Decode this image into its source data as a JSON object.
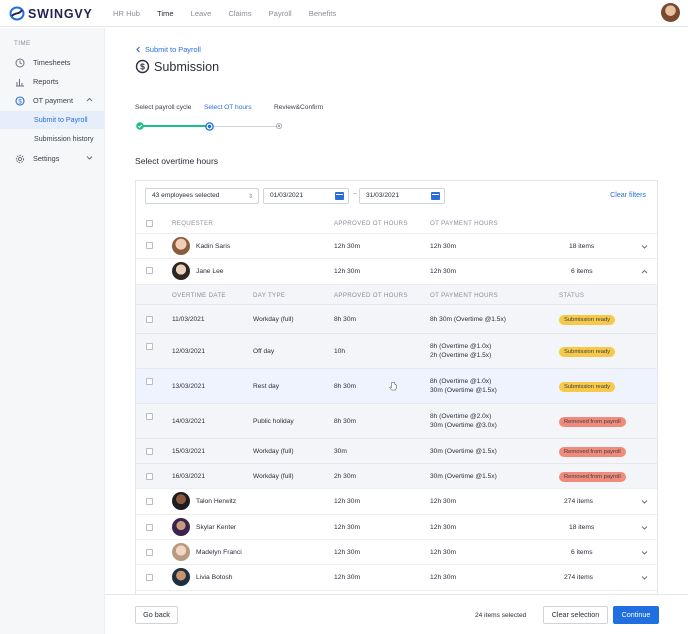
{
  "brand": {
    "name": "SWINGVY"
  },
  "nav": {
    "items": [
      "HR Hub",
      "Time",
      "Leave",
      "Claims",
      "Payroll",
      "Benefits"
    ],
    "active": "Time"
  },
  "sidebar": {
    "section": "TIME",
    "items": [
      {
        "label": "Timesheets",
        "icon": "clock-icon"
      },
      {
        "label": "Reports",
        "icon": "bar-chart-icon"
      },
      {
        "label": "OT payment",
        "icon": "dollar-circle-icon"
      },
      {
        "label": "Settings",
        "icon": "gear-icon"
      }
    ],
    "sub_items": [
      {
        "label": "Submit to Payroll",
        "active": true
      },
      {
        "label": "Submission history",
        "active": false
      }
    ]
  },
  "header": {
    "back_label": "Submit to Payroll",
    "title": "Submission"
  },
  "steps": [
    {
      "label": "Select payroll cycle",
      "state": "done"
    },
    {
      "label": "Select OT hours",
      "state": "active"
    },
    {
      "label": "Review&Confirm",
      "state": "pending"
    }
  ],
  "section_title": "Select overtime hours",
  "filters": {
    "employees": "43 employees selected",
    "date_from": "01/03/2021",
    "date_sep": "–",
    "date_to": "31/03/2021",
    "clear": "Clear filters"
  },
  "columns": {
    "requester": "REQUESTER",
    "approved": "APPROVED OT HOURS",
    "payment": "OT PAYMENT HOURS"
  },
  "sub_columns": {
    "date": "OVERTIME DATE",
    "day_type": "DAY TYPE",
    "approved": "APPROVED OT HOURS",
    "payment": "OT PAYMENT HOURS",
    "status": "STATUS"
  },
  "rows_before": [
    {
      "name": "Kadin Saris",
      "approved": "12h 30m",
      "payment": "12h 30m",
      "count": "18 items",
      "expanded": false
    },
    {
      "name": "Jane Lee",
      "approved": "12h 30m",
      "payment": "12h 30m",
      "count": "6 items",
      "expanded": true
    }
  ],
  "sub_rows": [
    {
      "date": "11/03/2021",
      "day_type": "Workday (full)",
      "approved": "8h 30m",
      "payment": [
        "8h 30m (Overtime @1.5x)"
      ],
      "status": "Submission ready",
      "status_kind": "ready"
    },
    {
      "date": "12/03/2021",
      "day_type": "Off day",
      "approved": "10h",
      "payment": [
        "8h (Overtime @1.0x)",
        "2h (Overtime @1.5x)"
      ],
      "status": "Submission ready",
      "status_kind": "ready"
    },
    {
      "date": "13/03/2021",
      "day_type": "Rest day",
      "approved": "8h 30m",
      "payment": [
        "8h (Overtime @1.0x)",
        "30m (Overtime @1.5x)"
      ],
      "status": "Submission ready",
      "status_kind": "ready"
    },
    {
      "date": "14/03/2021",
      "day_type": "Public holiday",
      "approved": "8h 30m",
      "payment": [
        "8h (Overtime @2.0x)",
        "30m (Overtime @3.0x)"
      ],
      "status": "Removed from payroll",
      "status_kind": "removed"
    },
    {
      "date": "15/03/2021",
      "day_type": "Workday (full)",
      "approved": "30m",
      "payment": [
        "30m (Overtime @1.5x)"
      ],
      "status": "Removed from payroll",
      "status_kind": "removed"
    },
    {
      "date": "16/03/2021",
      "day_type": "Workday (full)",
      "approved": "2h 30m",
      "payment": [
        "30m (Overtime @1.5x)"
      ],
      "status": "Removed from payroll",
      "status_kind": "removed"
    }
  ],
  "rows_after": [
    {
      "name": "Talon Herwitz",
      "approved": "12h 30m",
      "payment": "12h 30m",
      "count": "274 items"
    },
    {
      "name": "Skylar Kenter",
      "approved": "12h 30m",
      "payment": "12h 30m",
      "count": "18 items"
    },
    {
      "name": "Madelyn Franci",
      "approved": "12h 30m",
      "payment": "12h 30m",
      "count": "6 items"
    },
    {
      "name": "Livia Botosh",
      "approved": "12h 30m",
      "payment": "12h 30m",
      "count": "274 items"
    }
  ],
  "footer": {
    "back": "Go back",
    "selected": "24 items selected",
    "clear": "Clear selection",
    "continue": "Continue"
  },
  "colors": {
    "accent": "#1f6fe0",
    "done": "#1ec08a",
    "ready": "#f7c948",
    "removed": "#f08a7a"
  }
}
